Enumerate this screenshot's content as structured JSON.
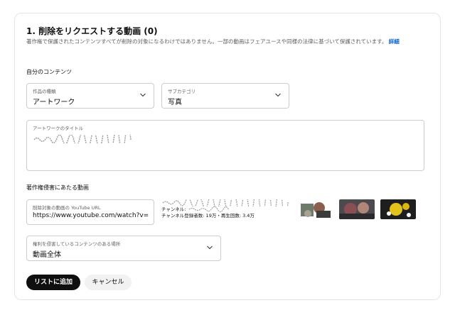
{
  "section": {
    "title": "1. 削除をリクエストする動画 (0)",
    "description": "著作権で保護されたコンテンツすべてが削除の対象になるわけではありません。一部の動画はフェアユースや同様の法律に基づいて保護されています。",
    "details_link": "詳細"
  },
  "own_content": {
    "label": "自分のコンテンツ",
    "work_type": {
      "label": "作品の種類",
      "value": "アートワーク"
    },
    "subcategory": {
      "label": "サブカテゴリ",
      "value": "写真"
    },
    "artwork_title": {
      "label": "アートワークのタイトル"
    }
  },
  "infringing": {
    "label": "著作権侵害にあたる動画",
    "url_field": {
      "label": "削除対象の動画の YouTube URL",
      "value": "https://www.youtube.com/watch?v=Fé"
    },
    "video_channel_prefix": "チャンネル:",
    "video_stats": "チャンネル登録者数: 19万・再生回数: 3.4万",
    "location": {
      "label": "権利を侵害しているコンテンツのある場所",
      "value": "動画全体"
    }
  },
  "buttons": {
    "add": "リストに追加",
    "cancel": "キャンセル"
  },
  "colors": {
    "link": "#065fd4",
    "primary_button": "#0f0f0f"
  },
  "icons": {
    "dropdown": "chevron-down-icon"
  }
}
